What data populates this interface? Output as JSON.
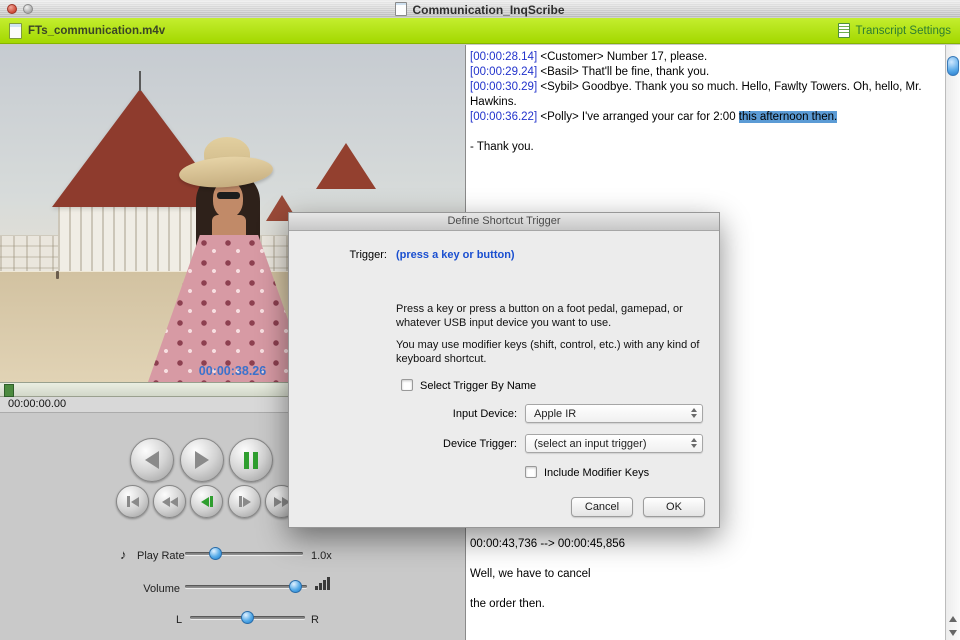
{
  "window": {
    "title": "Communication_InqScribe"
  },
  "media_bar": {
    "filename": "FTs_communication.m4v",
    "settings_label": "Transcript Settings"
  },
  "video": {
    "timecode": "00:00:38.26",
    "position_label": "00:00:00.00"
  },
  "controls": {
    "play_rate_label": "Play Rate",
    "play_rate_value": "1.0x",
    "volume_label": "Volume",
    "balance_left_label": "L",
    "balance_right_label": "R"
  },
  "transcript": {
    "lines": [
      {
        "time": "[00:00:28.14]",
        "text": " <Customer> Number 17, please."
      },
      {
        "time": "[00:00:29.24]",
        "text": " <Basil> That'll be fine, thank you."
      },
      {
        "time": "[00:00:30.29]",
        "text": " <Sybil> Goodbye. Thank you so much. Hello, Fawlty Towers. Oh, hello, Mr. Hawkins."
      },
      {
        "time": "[00:00:36.22]",
        "text": " <Polly> I've arranged your car for 2:00 ",
        "selected": "this afternoon then."
      }
    ],
    "closing_line": "- Thank you.",
    "srt": {
      "timecode": "00:00:43,736 --> 00:00:45,856",
      "line1": "Well, we have to cancel",
      "line2": "the order then."
    }
  },
  "dialog": {
    "title": "Define Shortcut Trigger",
    "trigger_label": "Trigger:",
    "trigger_value": "(press a key or button)",
    "help_text_1": "Press a key or press a button on a foot pedal, gamepad, or whatever USB input device you want to use.",
    "help_text_2": "You may use modifier keys (shift, control, etc.) with any kind of keyboard shortcut.",
    "select_trigger_label": "Select Trigger By Name",
    "input_device_label": "Input Device:",
    "input_device_value": "Apple IR",
    "device_trigger_label": "Device Trigger:",
    "device_trigger_value": "(select an input trigger)",
    "include_modifier_label": "Include Modifier Keys",
    "cancel_label": "Cancel",
    "ok_label": "OK"
  },
  "colors": {
    "accent_green": "#a8dc00",
    "timestamp_blue": "#2233cc",
    "selection_blue": "#5b9bd5",
    "link_blue": "#1a4fd0"
  }
}
